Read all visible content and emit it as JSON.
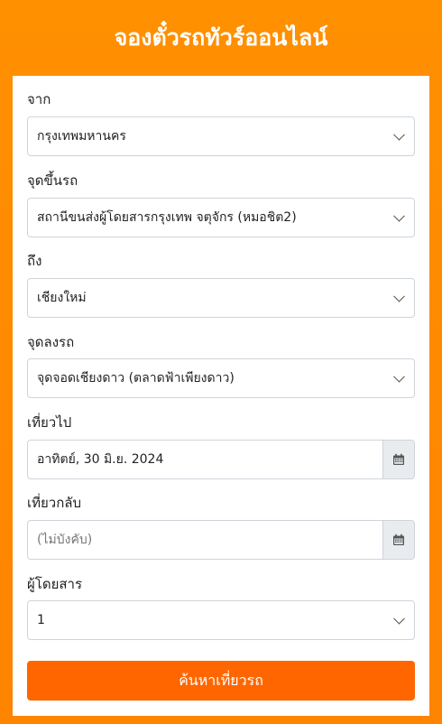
{
  "header": {
    "title": "จองตั๋วรถทัวร์ออนไลน์"
  },
  "form": {
    "from": {
      "label": "จาก",
      "value": "กรุงเทพมหานคร"
    },
    "pickup": {
      "label": "จุดขึ้นรถ",
      "value": "สถานีขนส่งผู้โดยสารกรุงเทพ จตุจักร (หมอชิต2)"
    },
    "to": {
      "label": "ถึง",
      "value": "เชียงใหม่"
    },
    "dropoff": {
      "label": "จุดลงรถ",
      "value": "จุดจอดเชียงดาว (ตลาดฟ้าเพียงดาว)"
    },
    "depart": {
      "label": "เที่ยวไป",
      "value": "อาทิตย์, 30 มิ.ย. 2024"
    },
    "return": {
      "label": "เที่ยวกลับ",
      "placeholder": "(ไม่บังคับ)"
    },
    "passengers": {
      "label": "ผู้โดยสาร",
      "value": "1"
    },
    "search_label": "ค้นหาเที่ยวรถ"
  },
  "icons": {
    "dropdown": "chevron-down-icon",
    "date": "calendar-icon"
  },
  "colors": {
    "accent": "#ff8a00",
    "button": "#ff6600"
  }
}
